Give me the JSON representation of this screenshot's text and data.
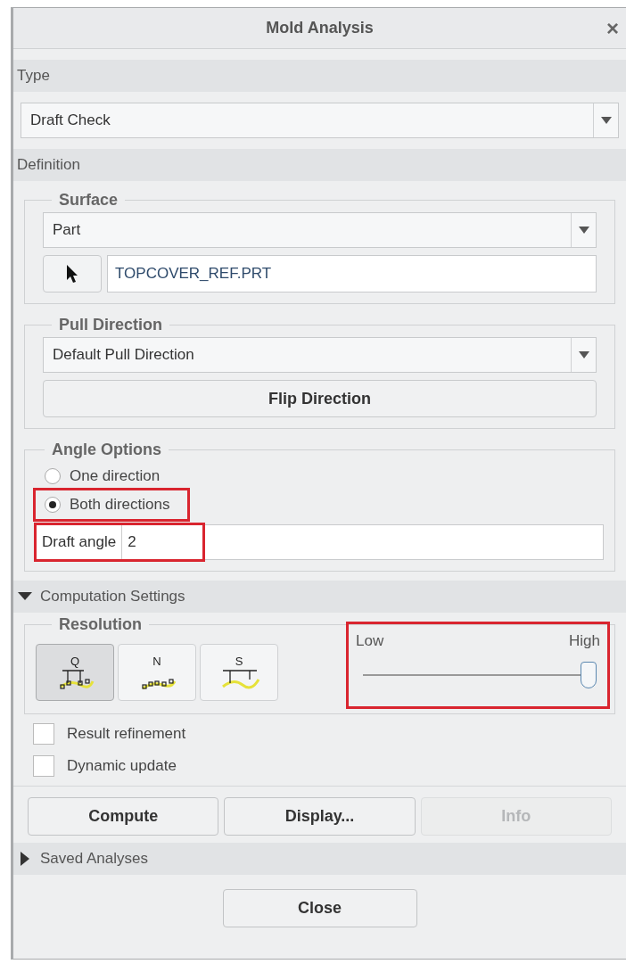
{
  "window": {
    "title": "Mold Analysis",
    "close": "×"
  },
  "type": {
    "header": "Type",
    "value": "Draft Check"
  },
  "definition": {
    "header": "Definition",
    "surface": {
      "legend": "Surface",
      "value": "Part",
      "reference": "TOPCOVER_REF.PRT"
    },
    "pull_direction": {
      "legend": "Pull Direction",
      "value": "Default Pull Direction",
      "button": "Flip Direction"
    },
    "angle_options": {
      "legend": "Angle Options",
      "options": [
        {
          "label": "One direction",
          "selected": false,
          "highlighted": false
        },
        {
          "label": "Both directions",
          "selected": true,
          "highlighted": true
        }
      ],
      "draft_angle": {
        "label": "Draft angle",
        "value": "2",
        "highlighted": true
      }
    }
  },
  "computation": {
    "header": "Computation Settings",
    "expanded": true,
    "resolution": {
      "legend": "Resolution",
      "modes": [
        {
          "glyph": "Q",
          "selected": true,
          "kind": "gap"
        },
        {
          "glyph": "N",
          "selected": false,
          "kind": "points"
        },
        {
          "glyph": "S",
          "selected": false,
          "kind": "span"
        }
      ],
      "slider": {
        "low": "Low",
        "high": "High",
        "level": 1,
        "highlighted": true
      }
    },
    "checks": [
      {
        "label": "Result refinement",
        "checked": false
      },
      {
        "label": "Dynamic update",
        "checked": false
      }
    ]
  },
  "actions": [
    {
      "label": "Compute",
      "disabled": false
    },
    {
      "label": "Display...",
      "disabled": false
    },
    {
      "label": "Info",
      "disabled": true
    }
  ],
  "saved": {
    "header": "Saved Analyses",
    "expanded": false
  },
  "footer": {
    "button": "Close"
  }
}
